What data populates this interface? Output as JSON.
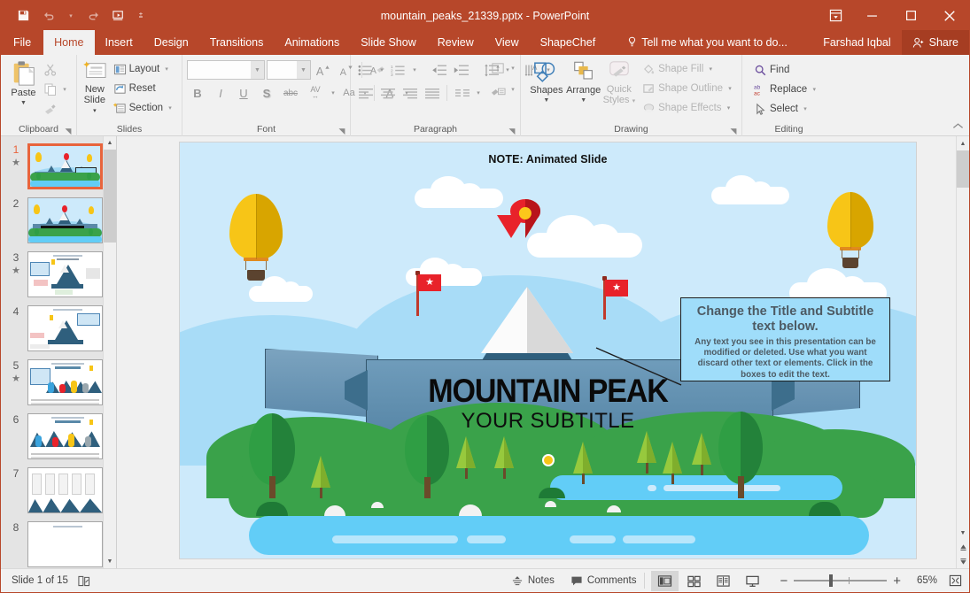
{
  "titlebar": {
    "document_title": "mountain_peaks_21339.pptx - PowerPoint",
    "qat": [
      {
        "name": "save-button",
        "icon": "save-icon",
        "label": "Save"
      },
      {
        "name": "undo-button",
        "icon": "undo-icon",
        "label": "Undo"
      },
      {
        "name": "redo-button",
        "icon": "redo-icon",
        "label": "Redo"
      },
      {
        "name": "start-presentation-button",
        "icon": "present-icon",
        "label": "Start From Beginning"
      },
      {
        "name": "customize-qat-button",
        "icon": "chevron-down-icon",
        "label": "Customize Quick Access Toolbar"
      }
    ],
    "window_buttons": {
      "ribbon_display": "Ribbon Display Options",
      "minimize": "Minimize",
      "maximize": "Restore Down",
      "close": "Close"
    }
  },
  "tabs": {
    "items": [
      {
        "label": "File",
        "active": false
      },
      {
        "label": "Home",
        "active": true
      },
      {
        "label": "Insert",
        "active": false
      },
      {
        "label": "Design",
        "active": false
      },
      {
        "label": "Transitions",
        "active": false
      },
      {
        "label": "Animations",
        "active": false
      },
      {
        "label": "Slide Show",
        "active": false
      },
      {
        "label": "Review",
        "active": false
      },
      {
        "label": "View",
        "active": false
      },
      {
        "label": "ShapeChef",
        "active": false
      }
    ],
    "tell_me": "Tell me what you want to do...",
    "user_name": "Farshad Iqbal",
    "share_label": "Share"
  },
  "ribbon": {
    "groups": {
      "clipboard": {
        "label": "Clipboard",
        "paste": "Paste",
        "cut": "Cut",
        "copy": "Copy",
        "format_painter": "Format Painter"
      },
      "slides": {
        "label": "Slides",
        "new_slide": "New\nSlide",
        "new_slide_line1": "New",
        "new_slide_line2": "Slide",
        "layout": "Layout",
        "reset": "Reset",
        "section": "Section"
      },
      "font": {
        "label": "Font",
        "font_name_value": "",
        "font_size_value": "",
        "grow_font": "Increase Font Size",
        "shrink_font": "Decrease Font Size",
        "clear_formatting": "Clear All Formatting",
        "bold": "B",
        "italic": "I",
        "underline": "U",
        "shadow": "S",
        "strikethrough": "abc",
        "character_spacing": "AV",
        "change_case": "Aa",
        "font_color": "A"
      },
      "paragraph": {
        "label": "Paragraph",
        "bullets": "Bullets",
        "numbering": "Numbering",
        "decrease_indent": "Decrease List Level",
        "increase_indent": "Increase List Level",
        "line_spacing": "Line Spacing",
        "text_direction": "Text Direction",
        "align_text": "Align Text",
        "convert_smartart": "Convert to SmartArt",
        "align_left": "Align Left",
        "align_center": "Center",
        "align_right": "Align Right",
        "justify": "Justify",
        "columns": "Columns"
      },
      "drawing": {
        "label": "Drawing",
        "shapes": "Shapes",
        "arrange": "Arrange",
        "quick_styles_line1": "Quick",
        "quick_styles_line2": "Styles",
        "shape_fill": "Shape Fill",
        "shape_outline": "Shape Outline",
        "shape_effects": "Shape Effects"
      },
      "editing": {
        "label": "Editing",
        "find": "Find",
        "replace": "Replace",
        "select": "Select"
      }
    },
    "collapse_label": "Collapse the Ribbon"
  },
  "thumbnails": {
    "slides": [
      {
        "number": "1",
        "animated": true,
        "selected": true,
        "kind": "hero"
      },
      {
        "number": "2",
        "animated": false,
        "selected": false,
        "kind": "hero"
      },
      {
        "number": "3",
        "animated": true,
        "selected": false,
        "kind": "diagram"
      },
      {
        "number": "4",
        "animated": false,
        "selected": false,
        "kind": "diagram"
      },
      {
        "number": "5",
        "animated": true,
        "selected": false,
        "kind": "steps"
      },
      {
        "number": "6",
        "animated": false,
        "selected": false,
        "kind": "steps"
      },
      {
        "number": "7",
        "animated": false,
        "selected": false,
        "kind": "columns"
      },
      {
        "number": "8",
        "animated": false,
        "selected": false,
        "kind": "columns"
      }
    ],
    "animated_marker": "★"
  },
  "slide": {
    "note": "NOTE: Animated Slide",
    "title": "MOUNTAIN PEAK",
    "subtitle": "YOUR SUBTITLE",
    "callout": {
      "heading": "Change the Title and Subtitle text below.",
      "body": "Any text you see in this presentation can be modified or deleted. Use what you want discard other text or elements. Click in the boxes to edit the text."
    },
    "colors": {
      "sky": "#cdeafb",
      "hill_far": "#a8dcf7",
      "mountain_dark": "#2f5f7d",
      "mountain_snow": "#f7f7f7",
      "grass": "#3aa24a",
      "water": "#62cdf7",
      "balloon": "#f7c517",
      "flag": "#e8222a",
      "pin": "#e8222a",
      "banner": "#5a89a8"
    }
  },
  "statusbar": {
    "slide_indicator": "Slide 1 of 15",
    "notes_label": "Notes",
    "comments_label": "Comments",
    "views": [
      {
        "name": "normal-view",
        "label": "Normal",
        "active": true
      },
      {
        "name": "slide-sorter-view",
        "label": "Slide Sorter",
        "active": false
      },
      {
        "name": "reading-view",
        "label": "Reading View",
        "active": false
      },
      {
        "name": "slide-show-view",
        "label": "Slide Show",
        "active": false
      }
    ],
    "zoom_out": "−",
    "zoom_in": "+",
    "zoom_level": "65%",
    "fit_label": "Fit slide to current window"
  }
}
